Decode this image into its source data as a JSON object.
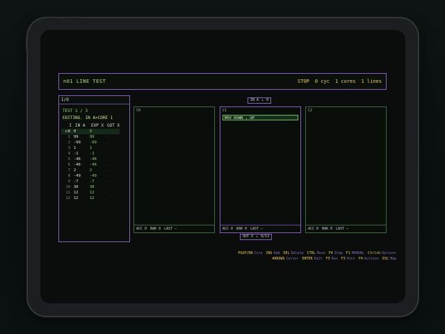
{
  "status": {
    "title": "n01  LINE TEST",
    "state": "STOP",
    "cycles": "0 cyc",
    "cores": "1 cores",
    "lines": "1 lines"
  },
  "io": {
    "title": "I/O",
    "test": "TEST 1 / 3",
    "editing": "EDITING.  IN A>CORE 1",
    "headers": [
      "I",
      "IN A",
      "EXP X",
      "GOT X"
    ],
    "rows": [
      {
        "i": "0",
        "in": "0",
        "exp": "0",
        "got": "."
      },
      {
        "i": "1",
        "in": "99",
        "exp": "99",
        "got": "."
      },
      {
        "i": "2",
        "in": "-99",
        "exp": "-99",
        "got": "."
      },
      {
        "i": "3",
        "in": "1",
        "exp": "1",
        "got": "."
      },
      {
        "i": "4",
        "in": "-1",
        "exp": "-1",
        "got": "."
      },
      {
        "i": "5",
        "in": "-46",
        "exp": "-46",
        "got": "."
      },
      {
        "i": "6",
        "in": "-46",
        "exp": "-46",
        "got": "."
      },
      {
        "i": "7",
        "in": "2",
        "exp": "2",
        "got": "."
      },
      {
        "i": "8",
        "in": "-49",
        "exp": "-49",
        "got": "."
      },
      {
        "i": "9",
        "in": "-7",
        "exp": "-7",
        "got": "."
      },
      {
        "i": "10",
        "in": "30",
        "exp": "30",
        "got": "."
      },
      {
        "i": "11",
        "in": "12",
        "exp": "12",
        "got": "."
      },
      {
        "i": "12",
        "in": "12",
        "exp": "12",
        "got": "."
      }
    ],
    "selected_row_marker": "▷"
  },
  "cores": [
    {
      "label": "C0",
      "acc": "ACC 0",
      "bak": "BAK 0",
      "last": "LAST –",
      "code": ""
    },
    {
      "label": "C1",
      "acc": "ACC 0",
      "bak": "BAK 0",
      "last": "LAST –",
      "code": " MOV  DOWN ,  UP"
    },
    {
      "label": "C2",
      "acc": "ACC 0",
      "bak": "BAK 0",
      "last": "LAST –",
      "code": ""
    }
  ],
  "ports": {
    "in": {
      "label": "IN A",
      "arrow": "↓",
      "value": "0"
    },
    "out": {
      "label": "OUT X",
      "arrow": "↓",
      "value": "0/13"
    }
  },
  "help": {
    "line1": [
      {
        "key": "PGUP/DN",
        "desc": "Core"
      },
      {
        "key": "INS",
        "desc": "Add"
      },
      {
        "key": "DEL",
        "desc": "Delete"
      },
      {
        "key": "CTRL",
        "desc": "Move"
      },
      {
        "key": "F4",
        "desc": "Step"
      },
      {
        "key": "F1",
        "desc": "MANUAL"
      },
      {
        "key": "Ctrl+G",
        "desc": "Options"
      }
    ],
    "line2": [
      {
        "key": "ARROWS",
        "desc": "Cursor"
      },
      {
        "key": "ENTER",
        "desc": "Edit"
      },
      {
        "key": "F5",
        "desc": "Run"
      },
      {
        "key": "F3",
        "desc": "Hist"
      },
      {
        "key": "F4",
        "desc": "Actions"
      },
      {
        "key": "ESC",
        "desc": "Map"
      }
    ]
  },
  "colors": {
    "accent_purple": "#8a5fc2",
    "text_green": "#8fdc6f",
    "text_yellow": "#f2cf52"
  }
}
